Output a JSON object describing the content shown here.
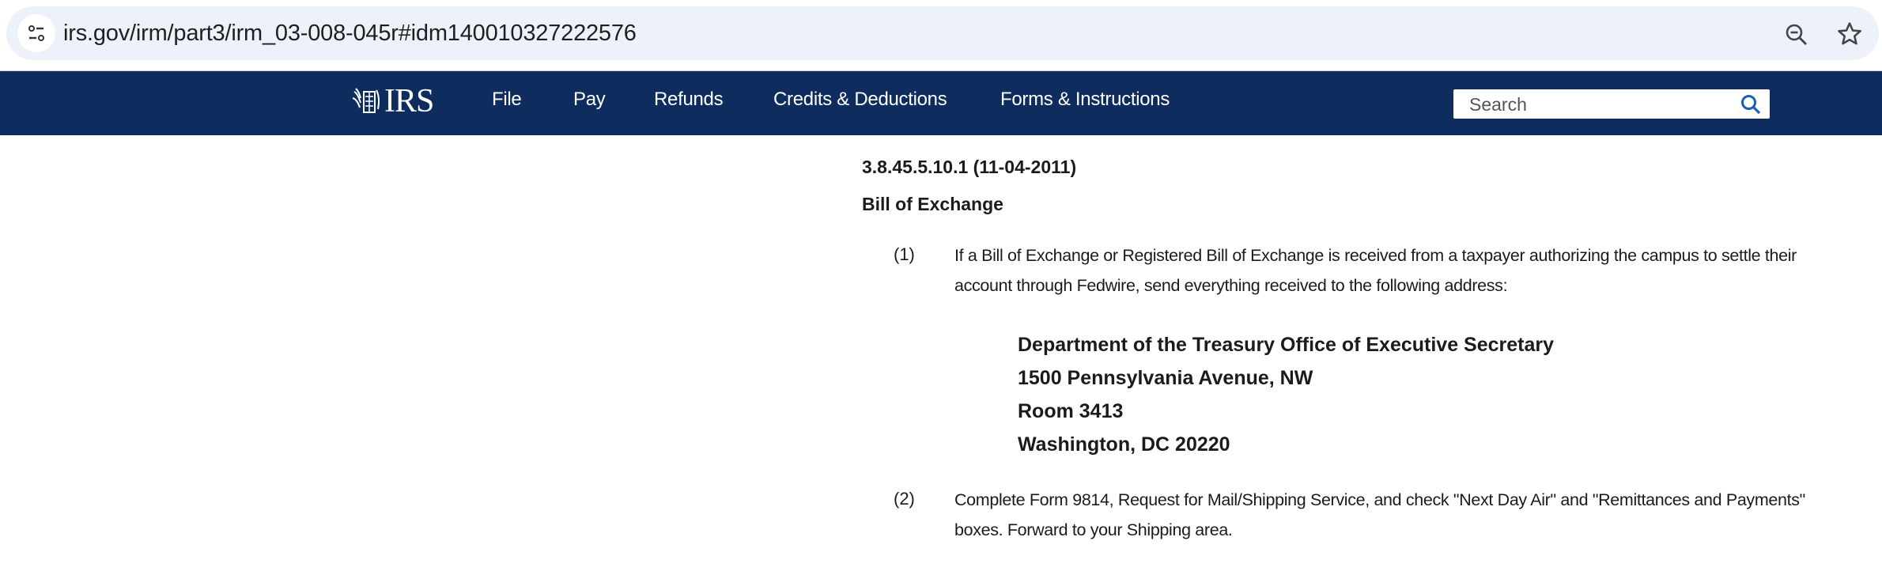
{
  "browser": {
    "url": "irs.gov/irm/part3/irm_03-008-045r#idm140010327222576",
    "icons": [
      "site-info-icon",
      "zoom-out-icon",
      "bookmark-star-icon"
    ]
  },
  "nav": {
    "logo": "IRS",
    "items": [
      {
        "label": "File"
      },
      {
        "label": "Pay"
      },
      {
        "label": "Refunds"
      },
      {
        "label": "Credits & Deductions"
      },
      {
        "label": "Forms & Instructions"
      }
    ],
    "search_placeholder": "Search",
    "bg_color": "#0f2c5e"
  },
  "section": {
    "number": "3.8.45.5.10.1 (11-04-2011)",
    "title": "Bill of Exchange",
    "items": [
      {
        "num": "(1)",
        "text": "If a Bill of Exchange or Registered Bill of Exchange is received from a taxpayer authorizing the campus to settle their account through Fedwire, send everything received to the following address:",
        "address": [
          "Department of the Treasury Office of Executive Secretary",
          "1500 Pennsylvania Avenue, NW",
          "Room 3413",
          "Washington, DC 20220"
        ]
      },
      {
        "num": "(2)",
        "text": "Complete Form 9814, Request for Mail/Shipping Service, and check \"Next Day Air\" and \"Remittances and Payments\" boxes. Forward to your Shipping area."
      }
    ]
  }
}
